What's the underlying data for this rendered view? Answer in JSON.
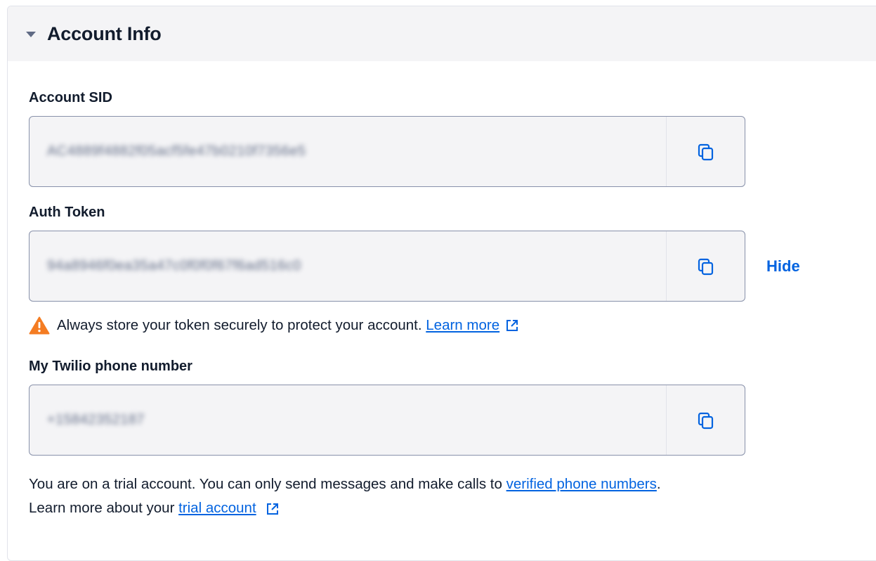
{
  "panel": {
    "title": "Account Info"
  },
  "fields": {
    "account_sid": {
      "label": "Account SID",
      "value": "AC4889f4882f05acf5fe47b0210f7356e5"
    },
    "auth_token": {
      "label": "Auth Token",
      "value": "94a8946f0ea35a47c0f0f0f67f6ad516c0",
      "hide_label": "Hide"
    },
    "phone_number": {
      "label": "My Twilio phone number",
      "value": "+15842352187"
    }
  },
  "warning": {
    "text": "Always store your token securely to protect your account.",
    "link": "Learn more"
  },
  "trial": {
    "line1_text": "You are on a trial account. You can only send messages and make calls to",
    "line1_link": "verified phone numbers",
    "line1_end": ".",
    "line2_text": "Learn more about your",
    "line2_link": "trial account"
  },
  "icons": {
    "copy": "copy-icon",
    "warning": "warning-icon",
    "external": "external-link-icon",
    "caret": "caret-down-icon"
  },
  "colors": {
    "link": "#0263e0",
    "warning": "#f47c22",
    "header_bg": "#f4f4f6",
    "field_bg": "#f4f4f6"
  }
}
